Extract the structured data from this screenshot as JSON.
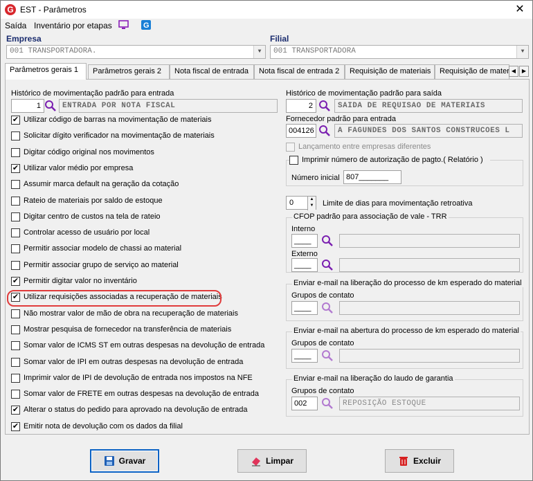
{
  "window": {
    "title": "EST - Parâmetros",
    "close": "✕"
  },
  "menu": {
    "exit": "Saída",
    "inventory": "Inventário por etapas"
  },
  "company": {
    "label": "Empresa",
    "value": "001 TRANSPORTADORA."
  },
  "branch": {
    "label": "Filial",
    "value": "001 TRANSPORTADORA"
  },
  "tabs": [
    "Parâmetros gerais 1",
    "Parâmetros gerais 2",
    "Nota fiscal de entrada",
    "Nota fiscal de entrada 2",
    "Requisição de materiais",
    "Requisição de materi"
  ],
  "left": {
    "history_in": {
      "label": "Histórico de movimentação padrão para entrada",
      "code": "1",
      "desc": "ENTRADA POR NOTA FISCAL"
    },
    "checkboxes": [
      {
        "label": "Utilizar código de barras na movimentação de materiais",
        "checked": true
      },
      {
        "label": "Solicitar dígito verificador na movimentação de materiais",
        "checked": false
      },
      {
        "label": "Digitar código original nos movimentos",
        "checked": false
      },
      {
        "label": "Utilizar valor médio por empresa",
        "checked": true
      },
      {
        "label": "Assumir marca default na geração da cotação",
        "checked": false
      },
      {
        "label": "Rateio de materiais por saldo de estoque",
        "checked": false
      },
      {
        "label": "Digitar centro de custos na tela de rateio",
        "checked": false
      },
      {
        "label": "Controlar acesso de usuário por local",
        "checked": false
      },
      {
        "label": "Permitir associar modelo de chassi ao material",
        "checked": false
      },
      {
        "label": "Permitir associar grupo de serviço ao material",
        "checked": false
      },
      {
        "label": "Permitir digitar valor no inventário",
        "checked": true
      },
      {
        "label": "Utilizar requisições associadas a recuperação de materiais",
        "checked": true
      },
      {
        "label": "Não mostrar valor de mão de obra na recuperação de materiais",
        "checked": false
      },
      {
        "label": "Mostrar pesquisa de fornecedor na transferência de materiais",
        "checked": false
      },
      {
        "label": "Somar valor de ICMS ST em outras despesas na devolução de entrada",
        "checked": false
      },
      {
        "label": "Somar valor de IPI em outras despesas na devolução de entrada",
        "checked": false
      },
      {
        "label": "Imprimir valor de IPI de devolução de entrada nos impostos na NFE",
        "checked": false
      },
      {
        "label": "Somar valor de FRETE em outras despesas na devolução de entrada",
        "checked": false
      },
      {
        "label": "Alterar o status do pedido para aprovado na devolução de entrada",
        "checked": true
      },
      {
        "label": "Emitir nota de devolução com os dados da filial",
        "checked": true
      }
    ]
  },
  "right": {
    "history_out": {
      "label": "Histórico de movimentação padrão para saída",
      "code": "2",
      "desc": "SAIDA DE REQUISAO DE MATERIAIS"
    },
    "supplier": {
      "label": "Fornecedor padrão para entrada",
      "code": "004126",
      "desc": "A FAGUNDES DOS SANTOS CONSTRUCOES L"
    },
    "inter_company": {
      "label": "Lançamento entre empresas diferentes"
    },
    "print_auth": {
      "label": "Imprimir número de autorização de pagto.( Relatório )",
      "initial_label": "Número inicial",
      "initial_value": "807_______"
    },
    "retro": {
      "value": "0",
      "label": "Limite de dias para movimentação retroativa"
    },
    "cfop": {
      "title": "CFOP padrão para associação de vale - TRR",
      "internal": "Interno",
      "internal_value": "____",
      "external": "Externo",
      "external_value": "____"
    },
    "email_km": {
      "title": "Enviar e-mail na liberação do processo de km esperado do material",
      "groups_label": "Grupos de contato",
      "value": "____"
    },
    "email_km_open": {
      "title": "Enviar e-mail na abertura do processo de km esperado do material",
      "groups_label": "Grupos de contato",
      "value": "____"
    },
    "email_warranty": {
      "title": "Enviar e-mail na liberação do laudo de garantia",
      "groups_label": "Grupos de contato",
      "value": "002",
      "desc": "REPOSIÇÃO ESTOQUE"
    }
  },
  "buttons": {
    "save": "Gravar",
    "clear": "Limpar",
    "delete": "Excluir"
  }
}
